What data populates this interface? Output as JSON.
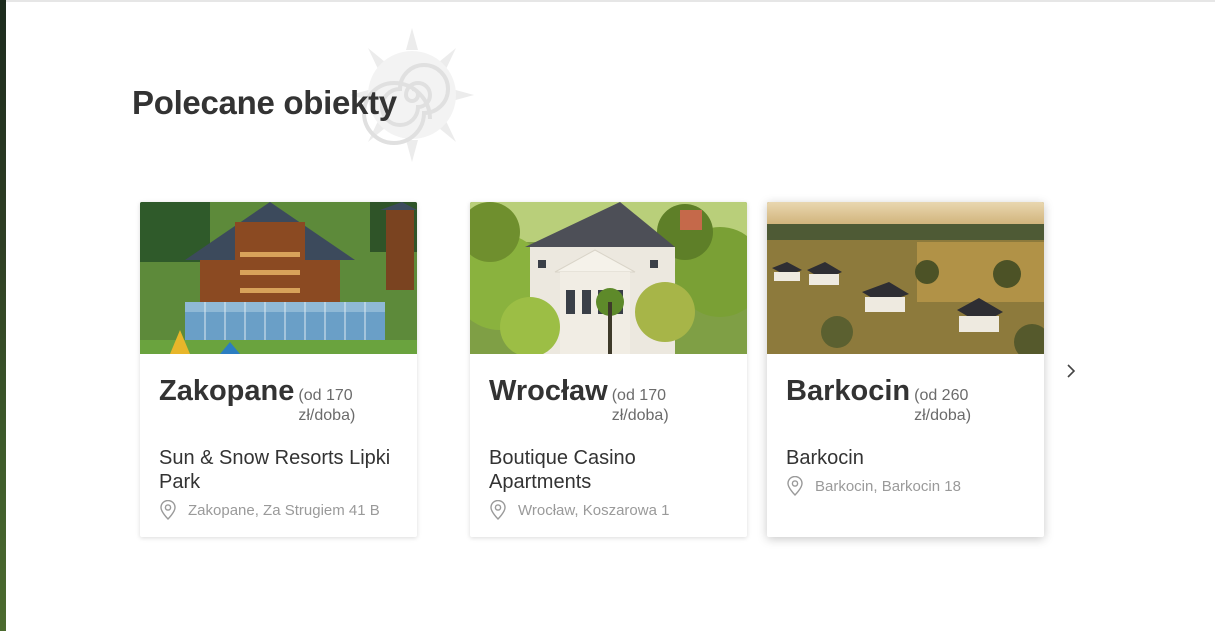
{
  "section": {
    "title": "Polecane obiekty"
  },
  "carousel": {
    "prev_icon": "chevron-left-icon",
    "next_icon": "chevron-right-icon",
    "cards": [
      {
        "city": "Wrocław",
        "price": "(od 170 zł/doba)",
        "property": "Boutique Casino Apartments",
        "address": "Wrocław, Koszarowa 1",
        "image": "palace-among-trees-photo"
      },
      {
        "city": "Barkocin",
        "price": "(od 260 zł/doba)",
        "property": "Barkocin",
        "address": "Barkocin, Barkocin 18",
        "image": "cabins-in-meadow-at-sunrise-photo"
      },
      {
        "city": "Zakopane",
        "price": "(od 170 zł/doba)",
        "property": "Sun & Snow Resorts Lipki Park",
        "address": "Zakopane, Za Strugiem 41 B",
        "image": "wooden-mountain-resort-photo"
      }
    ]
  },
  "colors": {
    "text": "#333333",
    "muted": "#9a9a9a",
    "price": "#6b6b6b",
    "background": "#ffffff"
  }
}
